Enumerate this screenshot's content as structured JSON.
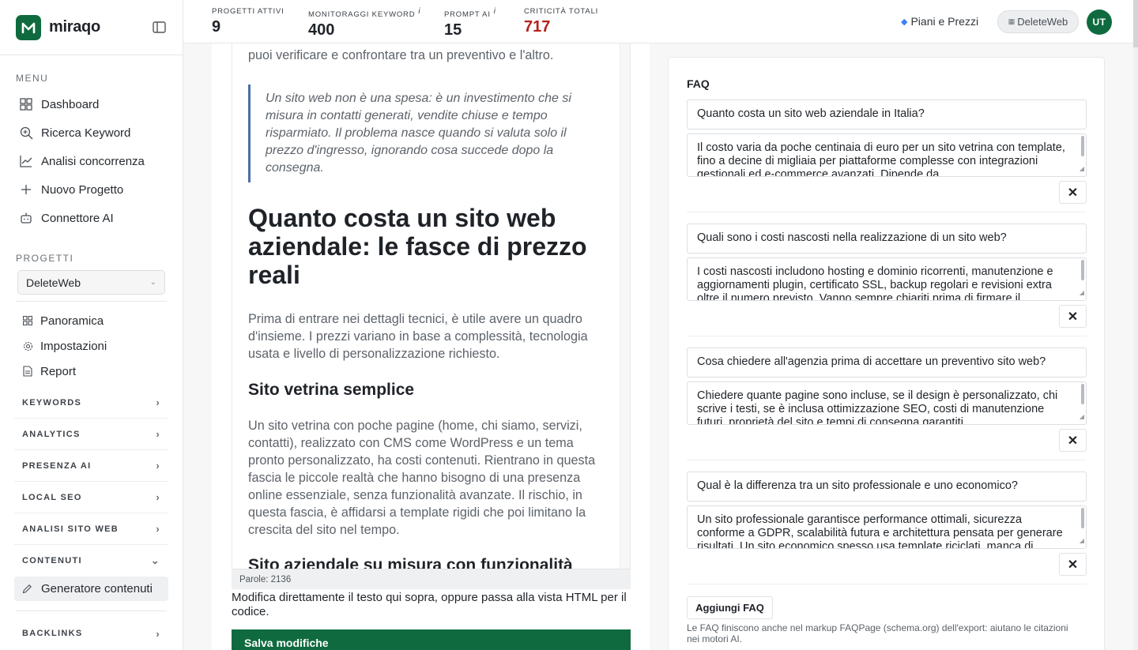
{
  "brand": {
    "name": "miraqo"
  },
  "sidebar": {
    "menu_title": "MENU",
    "menu": [
      {
        "label": "Dashboard",
        "icon": "grid-icon"
      },
      {
        "label": "Ricerca Keyword",
        "icon": "search-plus-icon"
      },
      {
        "label": "Analisi concorrenza",
        "icon": "line-chart-icon"
      },
      {
        "label": "Nuovo Progetto",
        "icon": "plus-icon"
      },
      {
        "label": "Connettore AI",
        "icon": "robot-icon"
      }
    ],
    "projects_title": "PROGETTI",
    "project_selected": "DeleteWeb",
    "project_items": [
      {
        "label": "Panoramica",
        "icon": "grid-small-icon"
      },
      {
        "label": "Impostazioni",
        "icon": "gear-icon"
      },
      {
        "label": "Report",
        "icon": "document-icon"
      }
    ],
    "groups": [
      "KEYWORDS",
      "ANALYTICS",
      "PRESENZA AI",
      "LOCAL SEO",
      "ANALISI SITO WEB",
      "CONTENUTI"
    ],
    "active_item": "Generatore contenuti",
    "bottom_group": "BACKLINKS"
  },
  "topbar": {
    "stats": [
      {
        "label": "PROGETTI ATTIVI",
        "value": "9",
        "info": ""
      },
      {
        "label": "MONITORAGGI KEYWORD",
        "value": "400",
        "info": "i"
      },
      {
        "label": "PROMPT AI",
        "value": "15",
        "info": "i"
      },
      {
        "label": "CRITICITÀ TOTALI",
        "value": "717",
        "info": ""
      }
    ],
    "plans_label": "Piani e Prezzi",
    "workspace": "DeleteWeb",
    "avatar": "UT",
    "colors": {
      "brand": "#0f6b3f",
      "danger": "#b42318"
    }
  },
  "editor": {
    "intro_tail": "puoi verificare e confrontare tra un preventivo e l'altro.",
    "quote": "Un sito web non è una spesa: è un investimento che si misura in contatti generati, vendite chiuse e tempo risparmiato. Il problema nasce quando si valuta solo il prezzo d'ingresso, ignorando cosa succede dopo la consegna.",
    "h1": "Quanto costa un sito web aziendale: le fasce di prezzo reali",
    "p1": "Prima di entrare nei dettagli tecnici, è utile avere un quadro d'insieme. I prezzi variano in base a complessità, tecnologia usata e livello di personalizzazione richiesto.",
    "h2a": "Sito vetrina semplice",
    "p2": "Un sito vetrina con poche pagine (home, chi siamo, servizi, contatti), realizzato con CMS come WordPress e un tema pronto personalizzato, ha costi contenuti. Rientrano in questa fascia le piccole realtà che hanno bisogno di una presenza online essenziale, senza funzionalità avanzate. Il rischio, in questa fascia, è affidarsi a template rigidi che poi limitano la crescita del sito nel tempo.",
    "h2b": "Sito aziendale su misura con funzionalità",
    "word_count": "Parole: 2136",
    "hint": "Modifica direttamente il testo qui sopra, oppure passa alla vista HTML per il codice.",
    "save_label": "Salva modifiche"
  },
  "faq": {
    "title": "FAQ",
    "items": [
      {
        "q": "Quanto costa un sito web aziendale in Italia?",
        "a": "Il costo varia da poche centinaia di euro per un sito vetrina con template, fino a decine di migliaia per piattaforme complesse con integrazioni gestionali ed e-commerce avanzati. Dipende da"
      },
      {
        "q": "Quali sono i costi nascosti nella realizzazione di un sito web?",
        "a": "I costi nascosti includono hosting e dominio ricorrenti, manutenzione e aggiornamenti plugin, certificato SSL, backup regolari e revisioni extra oltre il numero previsto. Vanno sempre chiariti prima di firmare il"
      },
      {
        "q": "Cosa chiedere all'agenzia prima di accettare un preventivo sito web?",
        "a": "Chiedere quante pagine sono incluse, se il design è personalizzato, chi scrive i testi, se è inclusa ottimizzazione SEO, costi di manutenzione futuri, proprietà del sito e tempi di consegna garantiti."
      },
      {
        "q": "Qual è la differenza tra un sito professionale e uno economico?",
        "a": "Un sito professionale garantisce performance ottimali, sicurezza conforme a GDPR, scalabilità futura e architettura pensata per generare risultati. Un sito economico spesso usa template riciclati, manca di"
      }
    ],
    "add_label": "Aggiungi FAQ",
    "note": "Le FAQ finiscono anche nel markup FAQPage (schema.org) dell'export: aiutano le citazioni nei motori AI."
  }
}
